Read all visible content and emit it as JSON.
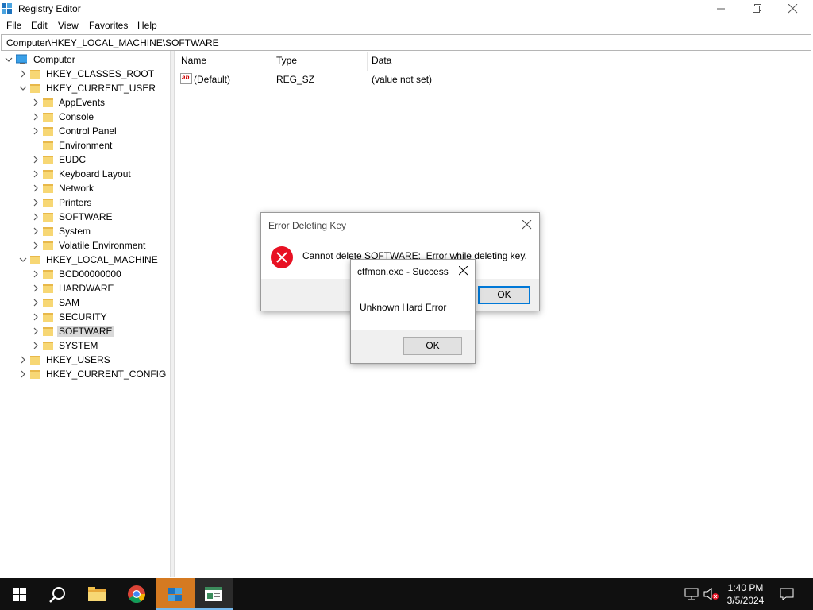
{
  "window": {
    "title": "Registry Editor",
    "menu": [
      "File",
      "Edit",
      "View",
      "Favorites",
      "Help"
    ],
    "address": "Computer\\HKEY_LOCAL_MACHINE\\SOFTWARE"
  },
  "tree": {
    "root": "Computer",
    "hkcr": "HKEY_CLASSES_ROOT",
    "hkcu": "HKEY_CURRENT_USER",
    "hkcu_children": [
      "AppEvents",
      "Console",
      "Control Panel",
      "Environment",
      "EUDC",
      "Keyboard Layout",
      "Network",
      "Printers",
      "SOFTWARE",
      "System",
      "Volatile Environment"
    ],
    "hklm": "HKEY_LOCAL_MACHINE",
    "hklm_children": [
      "BCD00000000",
      "HARDWARE",
      "SAM",
      "SECURITY",
      "SOFTWARE",
      "SYSTEM"
    ],
    "hku": "HKEY_USERS",
    "hkcc": "HKEY_CURRENT_CONFIG"
  },
  "list": {
    "columns": [
      "Name",
      "Type",
      "Data"
    ],
    "rows": [
      {
        "name": "(Default)",
        "type": "REG_SZ",
        "data": "(value not set)"
      }
    ]
  },
  "error_dialog": {
    "title": "Error Deleting Key",
    "message": "Cannot delete SOFTWARE:  Error while deleting key.",
    "ok_label": "OK"
  },
  "success_dialog": {
    "title": "ctfmon.exe - Success",
    "message": "Unknown Hard Error",
    "ok_label": "OK"
  },
  "taskbar": {
    "time": "1:40 PM",
    "date": "3/5/2024"
  },
  "colors": {
    "taskbar": "#101010",
    "accent": "#0078d7",
    "error_icon": "#e81123",
    "folder": "#f7d774"
  }
}
